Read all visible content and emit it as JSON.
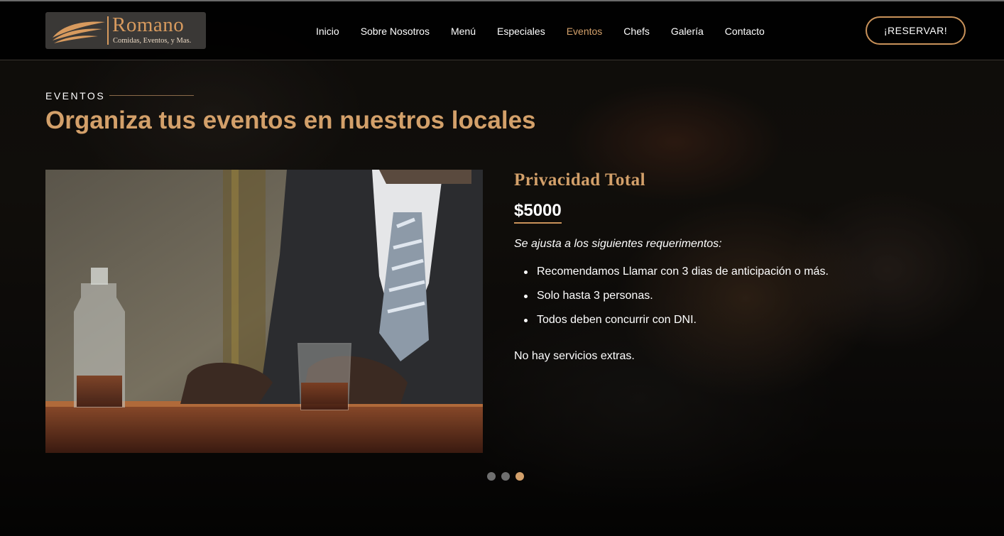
{
  "brand": {
    "name": "Romano",
    "tagline": "Comidas, Eventos, y Mas."
  },
  "nav": {
    "items": [
      {
        "label": "Inicio"
      },
      {
        "label": "Sobre Nosotros"
      },
      {
        "label": "Menú"
      },
      {
        "label": "Especiales"
      },
      {
        "label": "Eventos"
      },
      {
        "label": "Chefs"
      },
      {
        "label": "Galería"
      },
      {
        "label": "Contacto"
      }
    ],
    "active": "Eventos",
    "reserve_label": "¡RESERVAR!"
  },
  "section": {
    "label": "EVENTOS",
    "title": "Organiza tus eventos en nuestros locales"
  },
  "event": {
    "title": "Privacidad Total",
    "price": "$5000",
    "requirements_intro": "Se ajusta a los siguientes requerimentos:",
    "requirements": [
      "Recomendamos Llamar con 3 dias de anticipación o más.",
      "Solo hasta 3 personas.",
      "Todos deben concurrir con DNI."
    ],
    "extras": "No hay servicios extras."
  },
  "carousel": {
    "slide_count": 3,
    "active_slide": 3
  },
  "colors": {
    "accent": "#d3a06a",
    "header_bg": "#000000",
    "dot_inactive": "#6f6f6f"
  },
  "icons": {
    "logo_mark": "wings-logo-icon"
  }
}
